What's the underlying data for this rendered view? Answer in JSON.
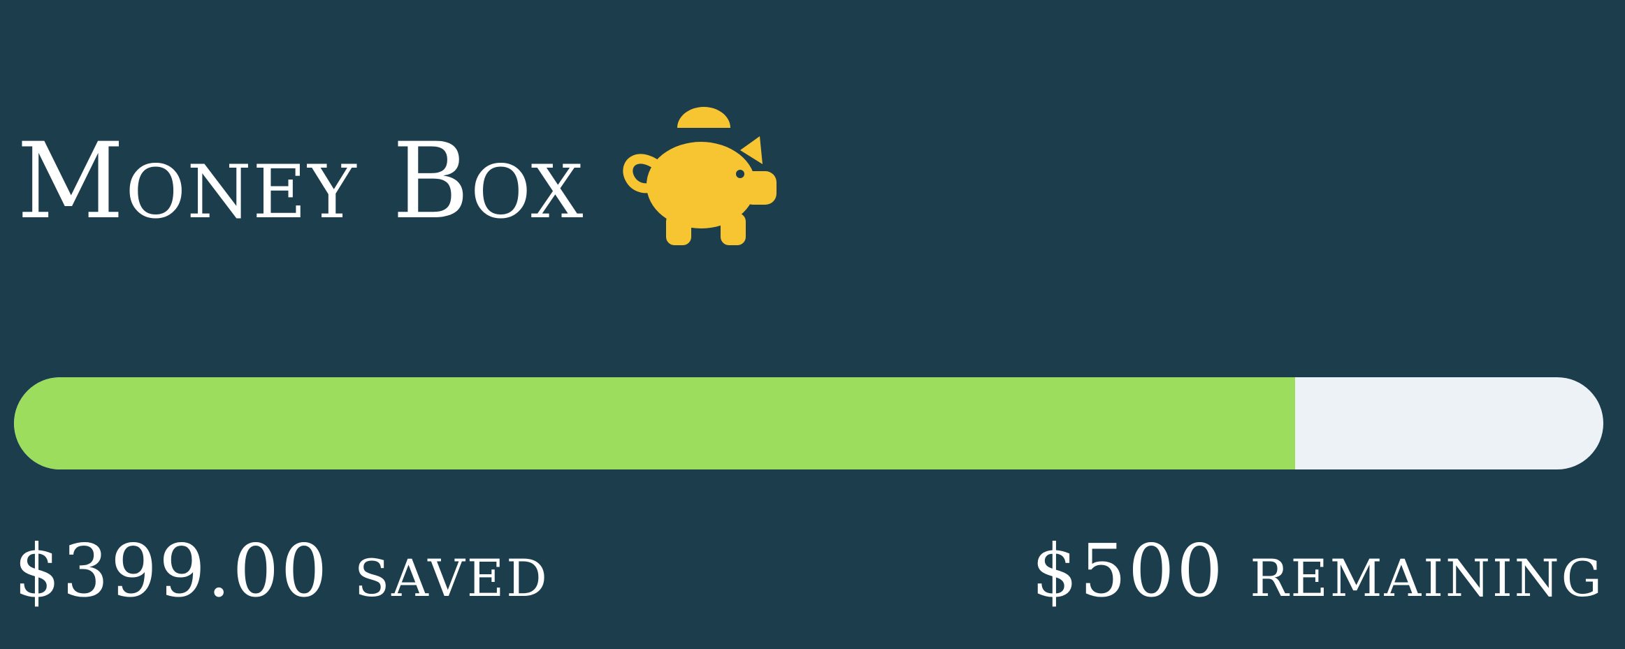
{
  "widget": {
    "title": "Money Box",
    "icon": "piggy-bank-icon",
    "saved_text": "$399.00 saved",
    "remaining_text": "$500 remaining",
    "progress_fraction": 0.806
  },
  "colors": {
    "background": "#1c3d4c",
    "progress_fill": "#9ddd5d",
    "progress_track": "#edf2f6",
    "icon": "#f7c531",
    "text": "#ffffff"
  }
}
